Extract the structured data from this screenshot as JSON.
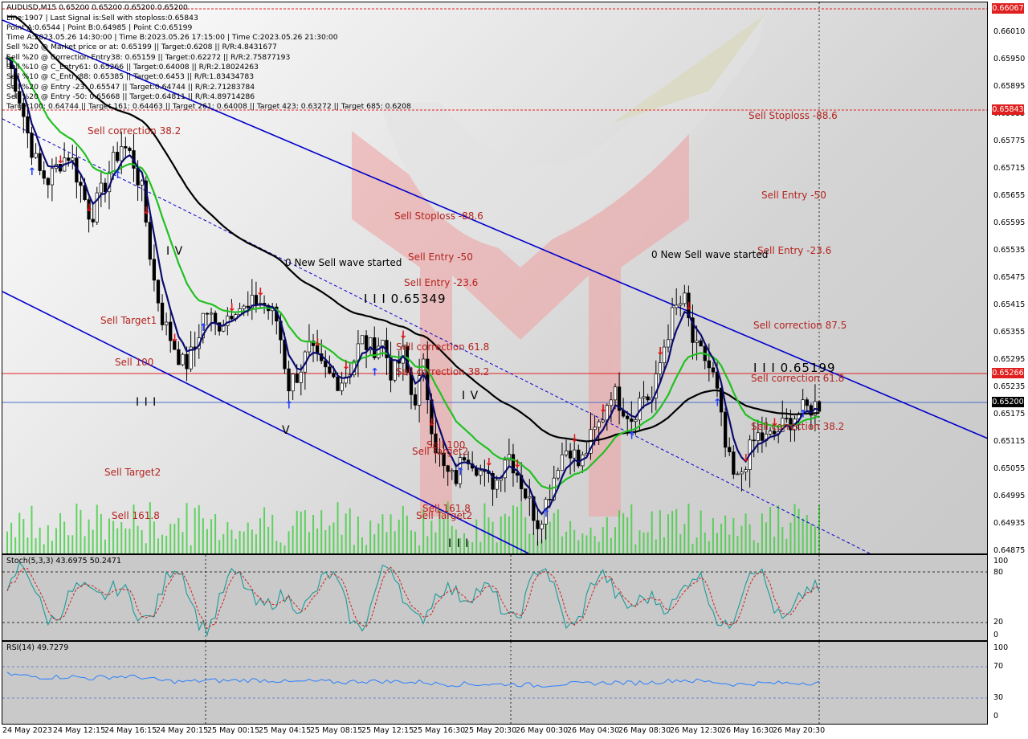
{
  "symbol_line": "AUDUSD,M15  0.65200 0.65200 0.65200 0.65200",
  "info_lines": [
    "Line:1907 | Last Signal is:Sell with stoploss:0.65843",
    "Point A:0.6544 | Point B:0.64985 | Point C:0.65199",
    "Time A:2023.05.26 14:30:00 | Time B:2023.05.26 17:15:00 | Time C:2023.05.26 21:30:00",
    "Sell %20 @ Market price or at: 0.65199 || Target:0.6208 || R/R:4.8431677",
    "Sell %20 @ Correction Entry38: 0.65159 || Target:0.62272 || R/R:2.75877193",
    "Sell %10 @ C_Entry61: 0.65266 || Target:0.64008 || R/R:2.18024263",
    "Sell %10 @ C_Entry88: 0.65385 || Target:0.6453 || R/R:1.83434783",
    "Sell %20 @ Entry -23: 0.65547 || Target:0.64744 || R/R:2.71283784",
    "Sell %20 @ Entry -50: 0.65668 || Target:0.64811 || R/R:4.89714286",
    "Target100: 0.64744 || Target 161: 0.64463 || Target 261: 0.64008 || Target 423: 0.63272 || Target 685: 0.6208"
  ],
  "price_labels": [
    {
      "text": "Sell Stoploss -88.6"
    },
    {
      "text": "Sell Entry -50"
    },
    {
      "text": "Sell Entry -23.6"
    },
    {
      "text": "Sell correction 87.5"
    },
    {
      "text": "Sell correction 61.8"
    },
    {
      "text": "Sell correction 38.2"
    },
    {
      "text": "Sell Stoploss -88.6"
    },
    {
      "text": "Sell Entry -50"
    },
    {
      "text": "Sell Entry -23.6"
    },
    {
      "text": "Sell correction 61.8"
    },
    {
      "text": "Sell correction 38.2"
    },
    {
      "text": "Sell correction 38.2"
    },
    {
      "text": "Sell Target1"
    },
    {
      "text": "Sell 100"
    },
    {
      "text": "Sell Target2"
    },
    {
      "text": "Sell 161.8"
    },
    {
      "text": "Sell 100"
    },
    {
      "text": "Sell Target2"
    },
    {
      "text": "Sell 161.8"
    },
    {
      "text": "Sell Target2"
    },
    {
      "text": "0 New Sell wave started"
    },
    {
      "text": "0 New Sell wave started"
    }
  ],
  "wave_labels": {
    "iv_a": "I V",
    "iv_b": "I V",
    "iii_a": "I I I",
    "iii_b": "I I I",
    "v_a": "V",
    "iii_price_a": "I I I 0.65349",
    "iii_price_b": "I I I 0.65199"
  },
  "price_axis": [
    "0.66067",
    "0.66010",
    "0.65950",
    "0.65895",
    "0.65835",
    "0.65775",
    "0.65715",
    "0.65655",
    "0.65595",
    "0.65535",
    "0.65475",
    "0.65415",
    "0.65355",
    "0.65295",
    "0.65235",
    "0.65175",
    "0.65115",
    "0.65055",
    "0.64995",
    "0.64935",
    "0.64875"
  ],
  "badges": {
    "top": "0.66067",
    "stoploss": "0.65843",
    "c61": "0.65266",
    "current": "0.65200"
  },
  "time_axis": [
    "24 May 2023",
    "24 May 12:15",
    "24 May 16:15",
    "24 May 20:15",
    "25 May 00:15",
    "25 May 04:15",
    "25 May 08:15",
    "25 May 12:15",
    "25 May 16:30",
    "25 May 20:30",
    "26 May 00:30",
    "26 May 04:30",
    "26 May 08:30",
    "26 May 12:30",
    "26 May 16:30",
    "26 May 20:30"
  ],
  "stoch": {
    "title": "Stoch(5,3,3) 43.6975 50.2471",
    "levels": [
      "100",
      "80",
      "20",
      "0"
    ]
  },
  "rsi": {
    "title": "RSI(14) 49.7279",
    "levels": [
      "100",
      "70",
      "30",
      "0"
    ]
  },
  "colors": {
    "bull": "#000000",
    "bear": "#000000",
    "ma_fast": "#0b0b6e",
    "ma_mid": "#22c022",
    "ma_slow": "#000000",
    "channel": "#0000cc",
    "level_red": "#e02020",
    "level_blue": "#4a6fc9",
    "stoch_main": "#1f9a9a",
    "stoch_signal": "#d02020",
    "rsi": "#2a7fff",
    "volume": "#33cc33"
  },
  "chart_data": {
    "type": "candlestick",
    "symbol": "AUDUSD",
    "timeframe": "M15",
    "ylim": [
      0.64875,
      0.66067
    ],
    "levels": {
      "stoploss": 0.65843,
      "c_entry61": 0.65266,
      "current": 0.652
    },
    "close_series": [
      0.6596,
      0.6589,
      0.6579,
      0.6571,
      0.6569,
      0.6573,
      0.6575,
      0.6568,
      0.6561,
      0.6566,
      0.6572,
      0.6577,
      0.6574,
      0.6566,
      0.6548,
      0.6538,
      0.6533,
      0.6528,
      0.6532,
      0.6541,
      0.6537,
      0.6539,
      0.6542,
      0.654,
      0.6543,
      0.6541,
      0.6538,
      0.6524,
      0.6527,
      0.6532,
      0.6528,
      0.6526,
      0.6525,
      0.6528,
      0.6534,
      0.6532,
      0.6534,
      0.6526,
      0.6531,
      0.652,
      0.6528,
      0.6512,
      0.6505,
      0.6503,
      0.651,
      0.6507,
      0.6503,
      0.6503,
      0.651,
      0.6505,
      0.6499,
      0.6494,
      0.65,
      0.6508,
      0.6511,
      0.6506,
      0.6512,
      0.6516,
      0.6523,
      0.652,
      0.6517,
      0.6522,
      0.6521,
      0.6532,
      0.654,
      0.6543,
      0.6532,
      0.653,
      0.6525,
      0.651,
      0.6502,
      0.6508,
      0.6513,
      0.6512,
      0.6514,
      0.6516,
      0.6518,
      0.6519,
      0.652
    ]
  }
}
